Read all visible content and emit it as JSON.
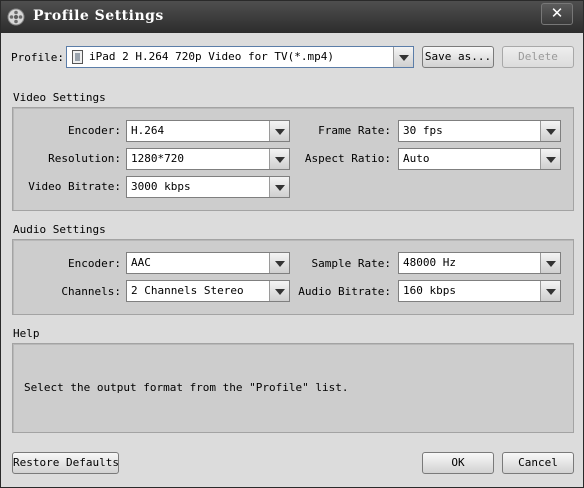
{
  "window": {
    "title": "Profile Settings",
    "close_glyph": "✕"
  },
  "profile": {
    "label": "Profile:",
    "value": "iPad 2 H.264 720p Video for TV(*.mp4)",
    "save_as": "Save as...",
    "delete": "Delete"
  },
  "video": {
    "title": "Video Settings",
    "encoder": {
      "label": "Encoder:",
      "value": "H.264"
    },
    "resolution": {
      "label": "Resolution:",
      "value": "1280*720"
    },
    "bitrate": {
      "label": "Video Bitrate:",
      "value": "3000 kbps"
    },
    "frame_rate": {
      "label": "Frame Rate:",
      "value": "30 fps"
    },
    "aspect_ratio": {
      "label": "Aspect Ratio:",
      "value": "Auto"
    }
  },
  "audio": {
    "title": "Audio Settings",
    "encoder": {
      "label": "Encoder:",
      "value": "AAC"
    },
    "channels": {
      "label": "Channels:",
      "value": "2 Channels Stereo"
    },
    "sample_rate": {
      "label": "Sample Rate:",
      "value": "48000 Hz"
    },
    "bitrate": {
      "label": "Audio Bitrate:",
      "value": "160 kbps"
    }
  },
  "help": {
    "title": "Help",
    "text": "Select the output format from the \"Profile\" list."
  },
  "footer": {
    "restore": "Restore Defaults",
    "ok": "OK",
    "cancel": "Cancel"
  },
  "icons": {
    "app": "film-reel-icon",
    "profile": "document-icon",
    "dropdown": "chevron-down-icon"
  }
}
